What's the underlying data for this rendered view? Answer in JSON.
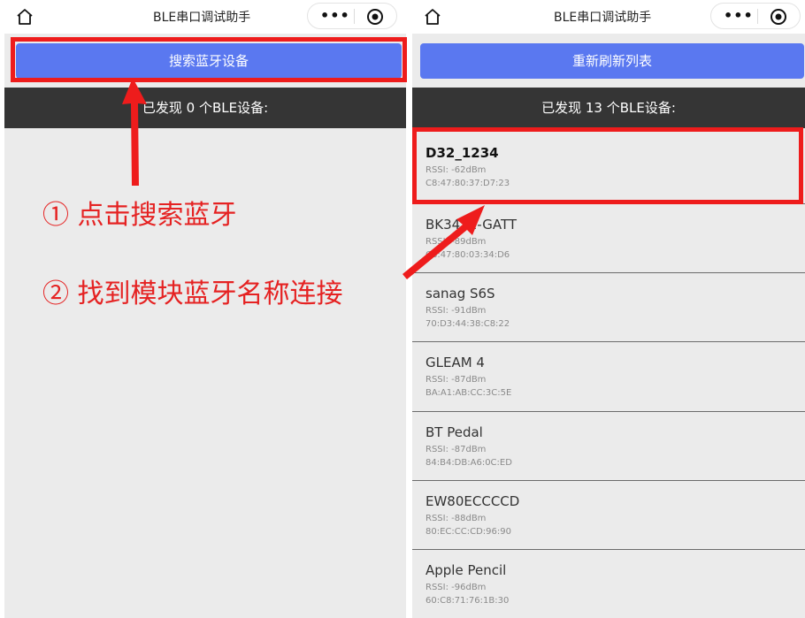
{
  "left_panel": {
    "title": "BLE串口调试助手",
    "search_button": "搜索蓝牙设备",
    "found_text": "已发现 0 个BLE设备:"
  },
  "right_panel": {
    "title": "BLE串口调试助手",
    "refresh_button": "重新刷新列表",
    "found_text": "已发现 13 个BLE设备:",
    "devices": [
      {
        "name": "D32_1234",
        "rssi": "RSSI: -62dBm",
        "mac": "C8:47:80:37:D7:23"
      },
      {
        "name": "BK3432-GATT",
        "rssi": "RSSI: -89dBm",
        "mac": "C8:47:80:03:34:D6"
      },
      {
        "name": "sanag S6S",
        "rssi": "RSSI: -91dBm",
        "mac": "70:D3:44:38:C8:22"
      },
      {
        "name": "GLEAM 4",
        "rssi": "RSSI: -87dBm",
        "mac": "BA:A1:AB:CC:3C:5E"
      },
      {
        "name": "BT Pedal",
        "rssi": "RSSI: -87dBm",
        "mac": "84:B4:DB:A6:0C:ED"
      },
      {
        "name": "EW80ECCCCD",
        "rssi": "RSSI: -88dBm",
        "mac": "80:EC:CC:CD:96:90"
      },
      {
        "name": "Apple Pencil",
        "rssi": "RSSI: -96dBm",
        "mac": "60:C8:71:76:1B:30"
      }
    ]
  },
  "annotations": {
    "step1": "① 点击搜索蓝牙",
    "step2": "② 找到模块蓝牙名称连接"
  },
  "icons": {
    "home": "home-icon",
    "more": "more-dots-icon",
    "close": "target-circle-icon"
  },
  "colors": {
    "button": "#5a78f0",
    "count_bar": "#353535",
    "annotation": "#ee1c1c",
    "panel_bg": "#ebebeb"
  }
}
